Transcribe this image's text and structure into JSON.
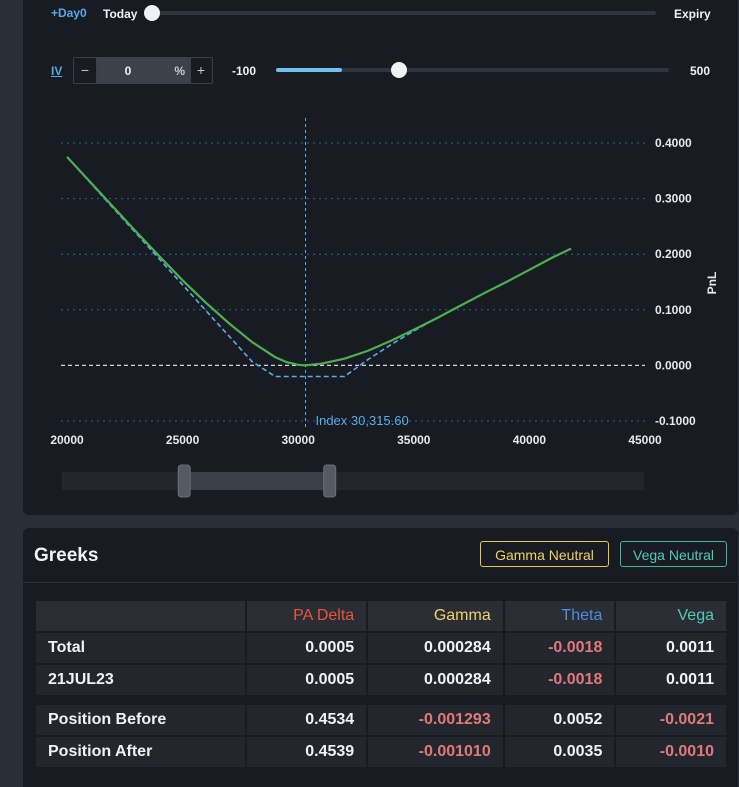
{
  "controls": {
    "day_label": "+Day0",
    "today_label": "Today",
    "expiry_label": "Expiry",
    "iv_label": "IV",
    "iv_minus": "−",
    "iv_value": "0",
    "iv_percent": "%",
    "iv_plus": "+",
    "iv_min_label": "-100",
    "iv_max_label": "500",
    "day_slider_fraction": 0.0,
    "iv_slider_fraction": 0.1667
  },
  "colors": {
    "curve": "#4caf50",
    "expiry_curve": "#5aaee8",
    "grid": "#2f78b8",
    "zero_line": "#e6e8ec",
    "index_line": "#5aaee8",
    "gamma": "#efd26a",
    "vega": "#52c9b9",
    "theta": "#4b8fe0",
    "delta": "#e8563a"
  },
  "chart_data": {
    "type": "line",
    "xlabel": "",
    "ylabel": "PnL",
    "xlim": [
      20000,
      45000
    ],
    "ylim": [
      -0.1,
      0.4
    ],
    "x_ticks": [
      "20000",
      "25000",
      "30000",
      "35000",
      "40000",
      "45000"
    ],
    "y_ticks": [
      "0.4000",
      "0.3000",
      "0.2000",
      "0.1000",
      "0.0000",
      "-0.1000"
    ],
    "y_tick_values": [
      0.4,
      0.3,
      0.2,
      0.1,
      0.0,
      -0.1
    ],
    "x_tick_values": [
      20000,
      25000,
      30000,
      35000,
      40000,
      45000
    ],
    "index_value": 30315.6,
    "index_label": "Index 30,315.60",
    "grid": true,
    "series": [
      {
        "x": [
          20000,
          21000,
          22000,
          23000,
          24000,
          25000,
          26000,
          27000,
          28000,
          29000,
          29500,
          30000,
          30315.6,
          31000,
          32000,
          33000,
          34000,
          35000,
          36000,
          37000,
          38000,
          39000,
          40000,
          41000,
          41800
        ],
        "y": [
          0.375,
          0.33,
          0.285,
          0.24,
          0.196,
          0.153,
          0.113,
          0.076,
          0.042,
          0.015,
          0.006,
          0.001,
          0.0,
          0.003,
          0.012,
          0.026,
          0.044,
          0.064,
          0.085,
          0.107,
          0.129,
          0.15,
          0.172,
          0.194,
          0.21
        ]
      },
      {
        "x": [
          20000,
          21000,
          22000,
          23000,
          24000,
          25000,
          26000,
          27000,
          28000,
          29000,
          32000,
          33000,
          34000,
          35000,
          36000,
          37000,
          38000,
          39000,
          40000,
          41000,
          41800
        ],
        "y": [
          0.375,
          0.329,
          0.283,
          0.237,
          0.191,
          0.145,
          0.099,
          0.053,
          0.007,
          -0.02,
          -0.02,
          0.01,
          0.037,
          0.062,
          0.085,
          0.107,
          0.129,
          0.15,
          0.172,
          0.194,
          0.21
        ]
      }
    ]
  },
  "range_selector": {
    "start_fraction": 0.21,
    "end_fraction": 0.46
  },
  "greeks": {
    "title": "Greeks",
    "gamma_neutral": "Gamma Neutral",
    "vega_neutral": "Vega Neutral",
    "headers": [
      "",
      "PA Delta",
      "Gamma",
      "Theta",
      "Vega"
    ],
    "rows": [
      {
        "label": "Total",
        "values": [
          "0.0005",
          "0.000284",
          "-0.0018",
          "0.0011"
        ]
      },
      {
        "label": "21JUL23",
        "values": [
          "0.0005",
          "0.000284",
          "-0.0018",
          "0.0011"
        ]
      },
      {
        "label": "Position Before",
        "values": [
          "0.4534",
          "-0.001293",
          "0.0052",
          "-0.0021"
        ]
      },
      {
        "label": "Position After",
        "values": [
          "0.4539",
          "-0.001010",
          "0.0035",
          "-0.0010"
        ]
      }
    ]
  }
}
